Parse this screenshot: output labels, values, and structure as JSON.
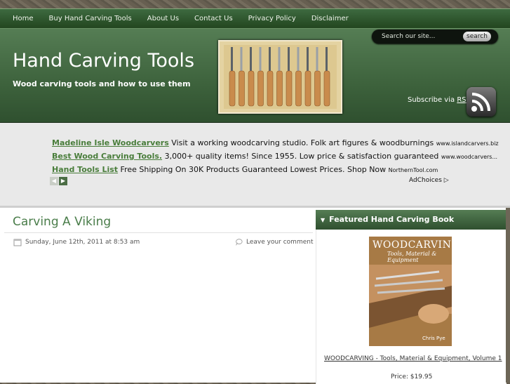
{
  "nav": {
    "items": [
      "Home",
      "Buy Hand Carving Tools",
      "About Us",
      "Contact Us",
      "Privacy Policy",
      "Disclaimer"
    ]
  },
  "header": {
    "title": "Hand Carving Tools",
    "description": "Wood carving tools and how to use them",
    "search_placeholder": "Search our site...",
    "search_button": "search",
    "subscribe_text": "Subscribe via ",
    "subscribe_link": "RSS"
  },
  "ads": [
    {
      "link": "Madeline Isle Woodcarvers",
      "text": " Visit a working woodcarving studio. Folk art figures & woodburnings ",
      "url": "www.islandcarvers.biz"
    },
    {
      "link": "Best Wood Carving Tools.",
      "text": " 3,000+ quality items! Since 1955. Low price & satisfaction guaranteed ",
      "url": "www.woodcarvers..."
    },
    {
      "link": "Hand Tools List",
      "text": " Free Shipping On 30K Products Guaranteed Lowest Prices. Shop Now ",
      "url": "NorthernTool.com"
    }
  ],
  "adchoices": "AdChoices",
  "post": {
    "title": "Carving A Viking",
    "date": "Sunday, June 12th, 2011 at 8:53 am",
    "comment": "Leave your comment"
  },
  "sidebar": {
    "heading": "Featured Hand Carving Book",
    "book_cover_title": "WOODCARVING",
    "book_cover_subtitle": "Tools, Material & Equipment",
    "book_cover_author": "Chris Pye",
    "book_link": "WOODCARVING - Tools, Material & Equipment, Volume 1",
    "price": "Price: $19.95"
  },
  "colors": {
    "nav_green": "#2f532d",
    "header_green": "#4a7049",
    "link_green": "#497d3b",
    "title_green": "#4a7d4a"
  }
}
